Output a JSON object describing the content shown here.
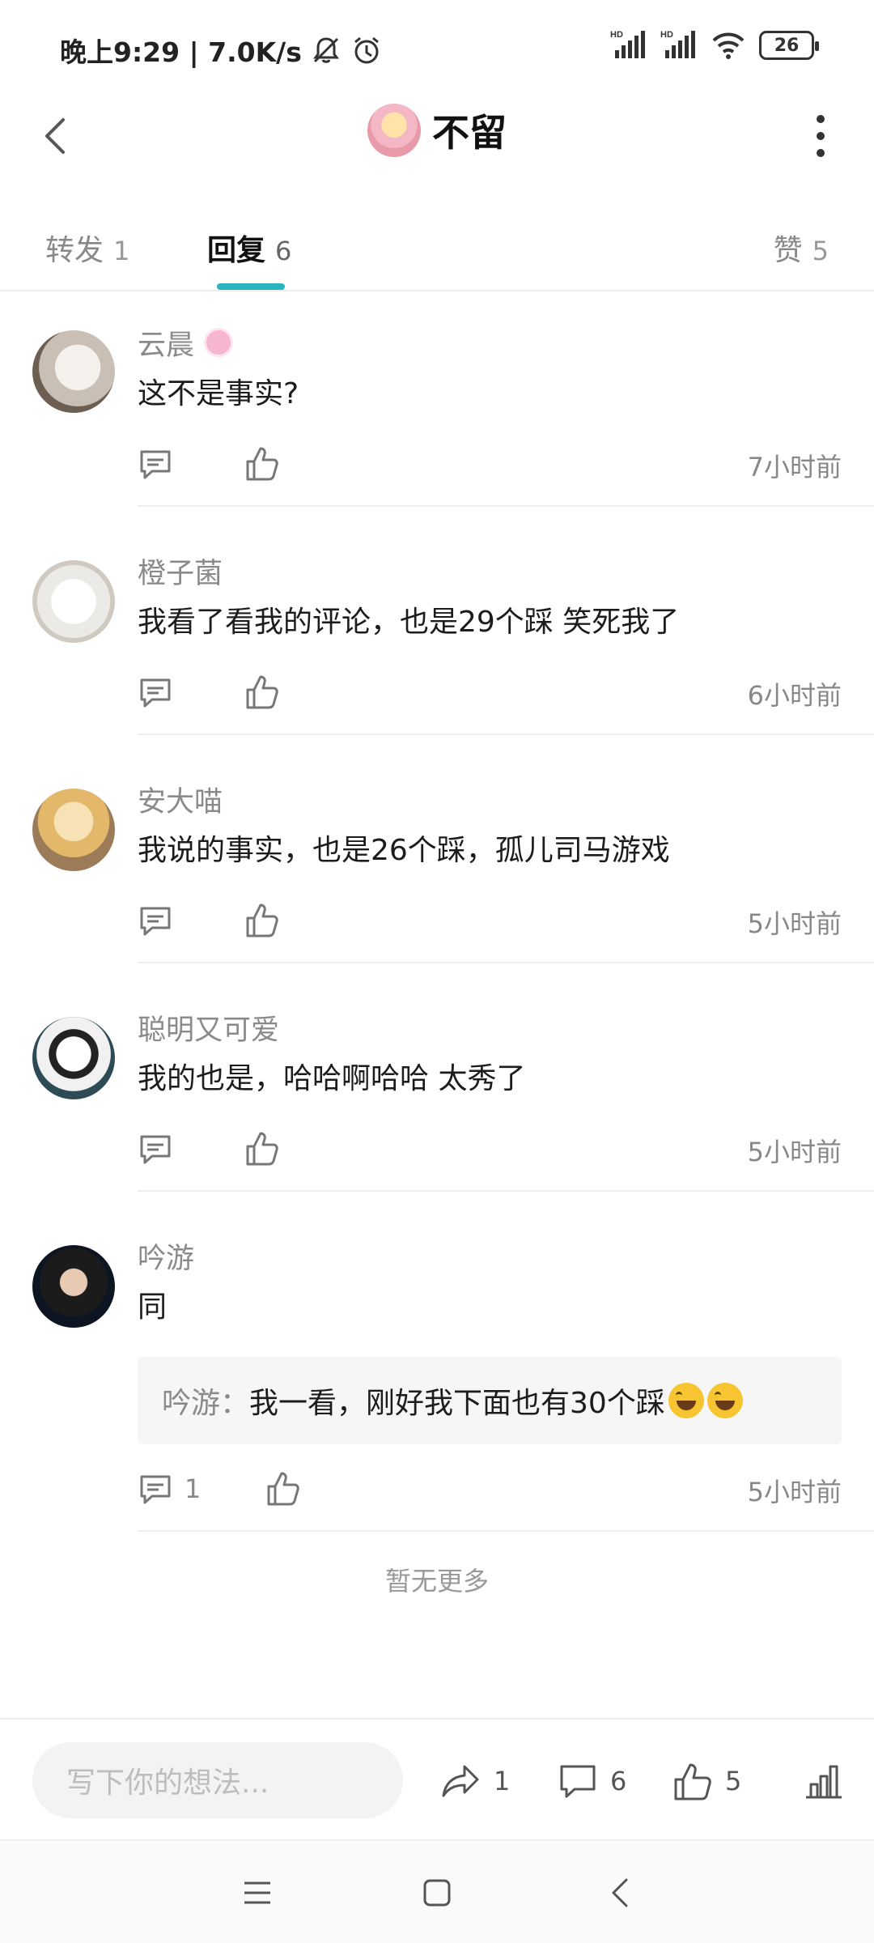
{
  "status_bar": {
    "time_speed": "晚上9:29 | 7.0K/s",
    "signal_1_label": "HD",
    "signal_2_label": "HD",
    "battery": "26"
  },
  "header": {
    "title": "不留"
  },
  "tabs": [
    {
      "label": "转发",
      "count": "1"
    },
    {
      "label": "回复",
      "count": "6"
    },
    {
      "label": "赞",
      "count": "5"
    }
  ],
  "comments": [
    {
      "name": "云晨",
      "text": "这不是事实?",
      "time": "7小时前",
      "reply_count": ""
    },
    {
      "name": "橙子菌",
      "text": "我看了看我的评论，也是29个踩 笑死我了",
      "time": "6小时前",
      "reply_count": ""
    },
    {
      "name": "安大喵",
      "text": "我说的事实，也是26个踩，孤儿司马游戏",
      "time": "5小时前",
      "reply_count": ""
    },
    {
      "name": "聪明又可爱",
      "text": "我的也是，哈哈啊哈哈  太秀了",
      "time": "5小时前",
      "reply_count": ""
    },
    {
      "name": "吟游",
      "text": "同",
      "time": "5小时前",
      "reply_count": "1",
      "quote": {
        "name": "吟游",
        "separator": "：",
        "text": "我一看，刚好我下面也有30个踩"
      }
    }
  ],
  "no_more": "暂无更多",
  "bottom_bar": {
    "input_placeholder": "写下你的想法...",
    "repost_count": "1",
    "comment_count": "6",
    "like_count": "5"
  },
  "colors": {
    "accent": "#2bb3be"
  }
}
